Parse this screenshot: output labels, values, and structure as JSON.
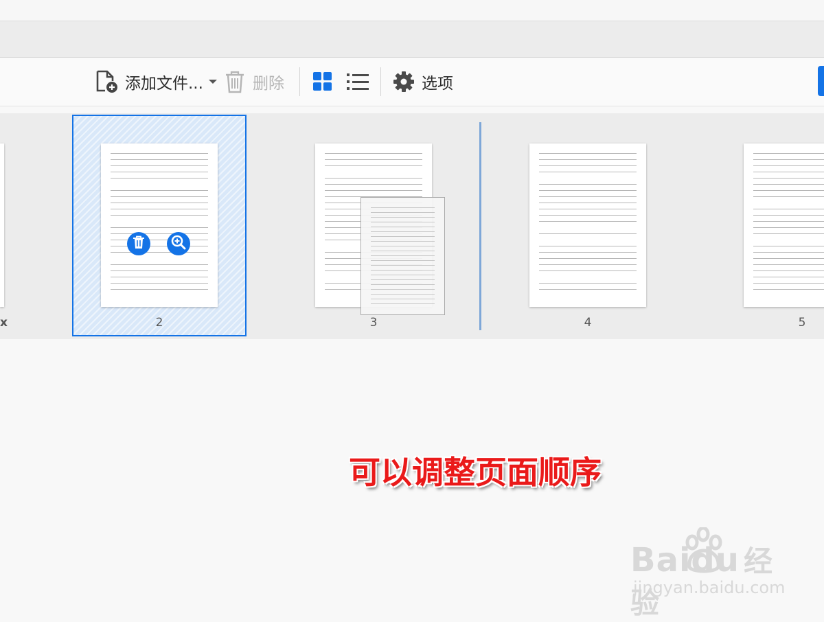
{
  "toolbar": {
    "add_files_label": "添加文件...",
    "delete_label": "删除",
    "options_label": "选项",
    "icons": {
      "add_file": "add-file-icon",
      "delete": "trash-icon",
      "grid_view": "grid-view-icon",
      "list_view": "list-view-icon",
      "options": "gear-icon"
    }
  },
  "pages": [
    {
      "label": "2",
      "selected": true,
      "actions": [
        "delete-icon",
        "zoom-icon"
      ]
    },
    {
      "label": "3",
      "selected": false
    },
    {
      "label": "4",
      "selected": false
    },
    {
      "label": "5",
      "selected": false
    }
  ],
  "partial_left_label": "x",
  "caption": "可以调整页面顺序",
  "watermark": {
    "brand": "Baidu",
    "cn": "经验",
    "url": "jingyan.baidu.com"
  },
  "colors": {
    "accent": "#1473e6",
    "caption": "#ea1a1a"
  }
}
